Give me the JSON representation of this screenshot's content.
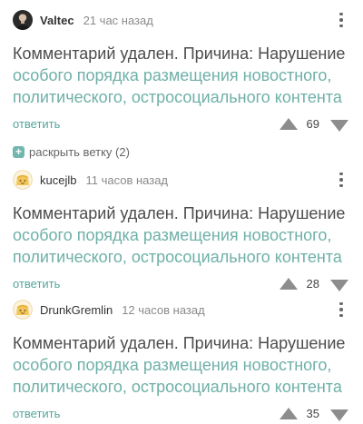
{
  "comments": [
    {
      "author": "Valtec",
      "time": "21 час назад",
      "text_plain": "Комментарий удален. Причина: Нарушение",
      "text_link": "особого порядка размещения новостного, политического, остросоциального контента",
      "reply_label": "ответить",
      "rating": "69"
    },
    {
      "author": "kucejlb",
      "time": "11 часов назад",
      "text_plain": "Комментарий удален. Причина: Нарушение",
      "text_link": "особого порядка размещения новостного, политического, остросоциального контента",
      "reply_label": "ответить",
      "rating": "28"
    },
    {
      "author": "DrunkGremlin",
      "time": "12 часов назад",
      "text_plain": "Комментарий удален. Причина: Нарушение",
      "text_link": "особого порядка размещения новостного, политического, остросоциального контента",
      "reply_label": "ответить",
      "rating": "35"
    }
  ],
  "thread": {
    "expand_icon": "+",
    "expand_label": "раскрыть ветку (2)"
  },
  "colors": {
    "link": "#6fb0a8",
    "reply": "#55a59c",
    "arrow": "#8d8d8d",
    "expand_box": "#72b7ad"
  },
  "icons": {
    "more": "vertical-ellipsis-icon",
    "up": "arrow-up-icon",
    "down": "arrow-down-icon",
    "expand": "plus-square-icon"
  }
}
